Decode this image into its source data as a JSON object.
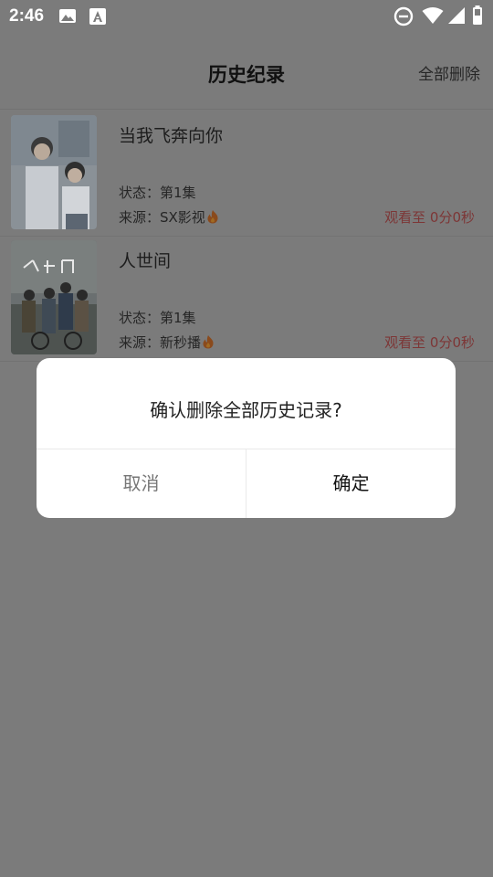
{
  "status_bar": {
    "time": "2:46",
    "icons": [
      "image-notification-icon",
      "text-notification-icon",
      "do-not-disturb-icon",
      "wifi-icon",
      "signal-icon",
      "battery-icon"
    ]
  },
  "header": {
    "title": "历史纪录",
    "delete_all": "全部删除"
  },
  "history": [
    {
      "title": "当我飞奔向你",
      "status": "状态：第1集",
      "source": "来源：SX影视",
      "progress": "观看至 0分0秒"
    },
    {
      "title": "人世间",
      "status": "状态：第1集",
      "source": "来源：新秒播",
      "progress": "观看至 0分0秒"
    }
  ],
  "dialog": {
    "message": "确认删除全部历史记录?",
    "cancel": "取消",
    "confirm": "确定"
  },
  "colors": {
    "overlay": "#7b7b7b",
    "progress_text": "#7d3636",
    "dialog_bg": "#ffffff"
  }
}
